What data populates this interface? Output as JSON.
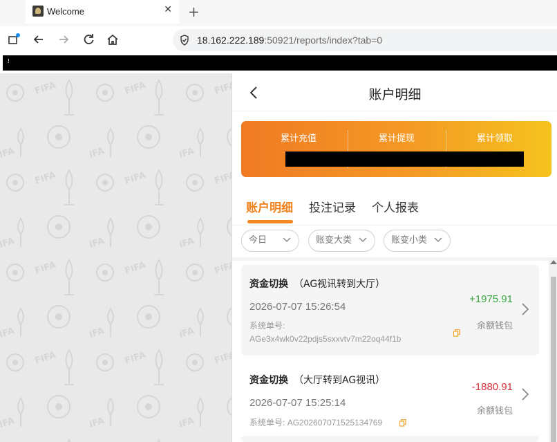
{
  "browser": {
    "tab_title": "Welcome",
    "new_tab": "+",
    "close": "✕",
    "url_host": "18.162.222.189",
    "url_rest": ":50921/reports/index?tab=0",
    "redact_marker": "!"
  },
  "header": {
    "title": "账户明细"
  },
  "summary": {
    "labels": [
      "累计充值",
      "累计提现",
      "累计领取"
    ]
  },
  "tabs": [
    {
      "label": "账户明细",
      "active": true
    },
    {
      "label": "投注记录",
      "active": false
    },
    {
      "label": "个人报表",
      "active": false
    }
  ],
  "filters": [
    {
      "label": "今日"
    },
    {
      "label": "账变大类"
    },
    {
      "label": "账变小类"
    }
  ],
  "records": [
    {
      "title": "资金切换",
      "detail": "（AG视讯转到大厅）",
      "time": "2026-07-07 15:26:54",
      "amount": "+1975.91",
      "wallet": "余额钱包",
      "order_label": "系统单号:",
      "order_no": "AGe3x4wk0v22pdjs5sxxvtv7m22oq44f1b"
    },
    {
      "title": "资金切换",
      "detail": "（大厅转到AG视讯）",
      "time": "2026-07-07 15:25:14",
      "amount": "-1880.91",
      "wallet": "余额钱包",
      "order_label": "系统单号:",
      "order_no": "AG202607071525134769"
    }
  ],
  "colors": {
    "accent": "#f0821e",
    "positive": "#3aa640",
    "negative": "#d8303a"
  }
}
